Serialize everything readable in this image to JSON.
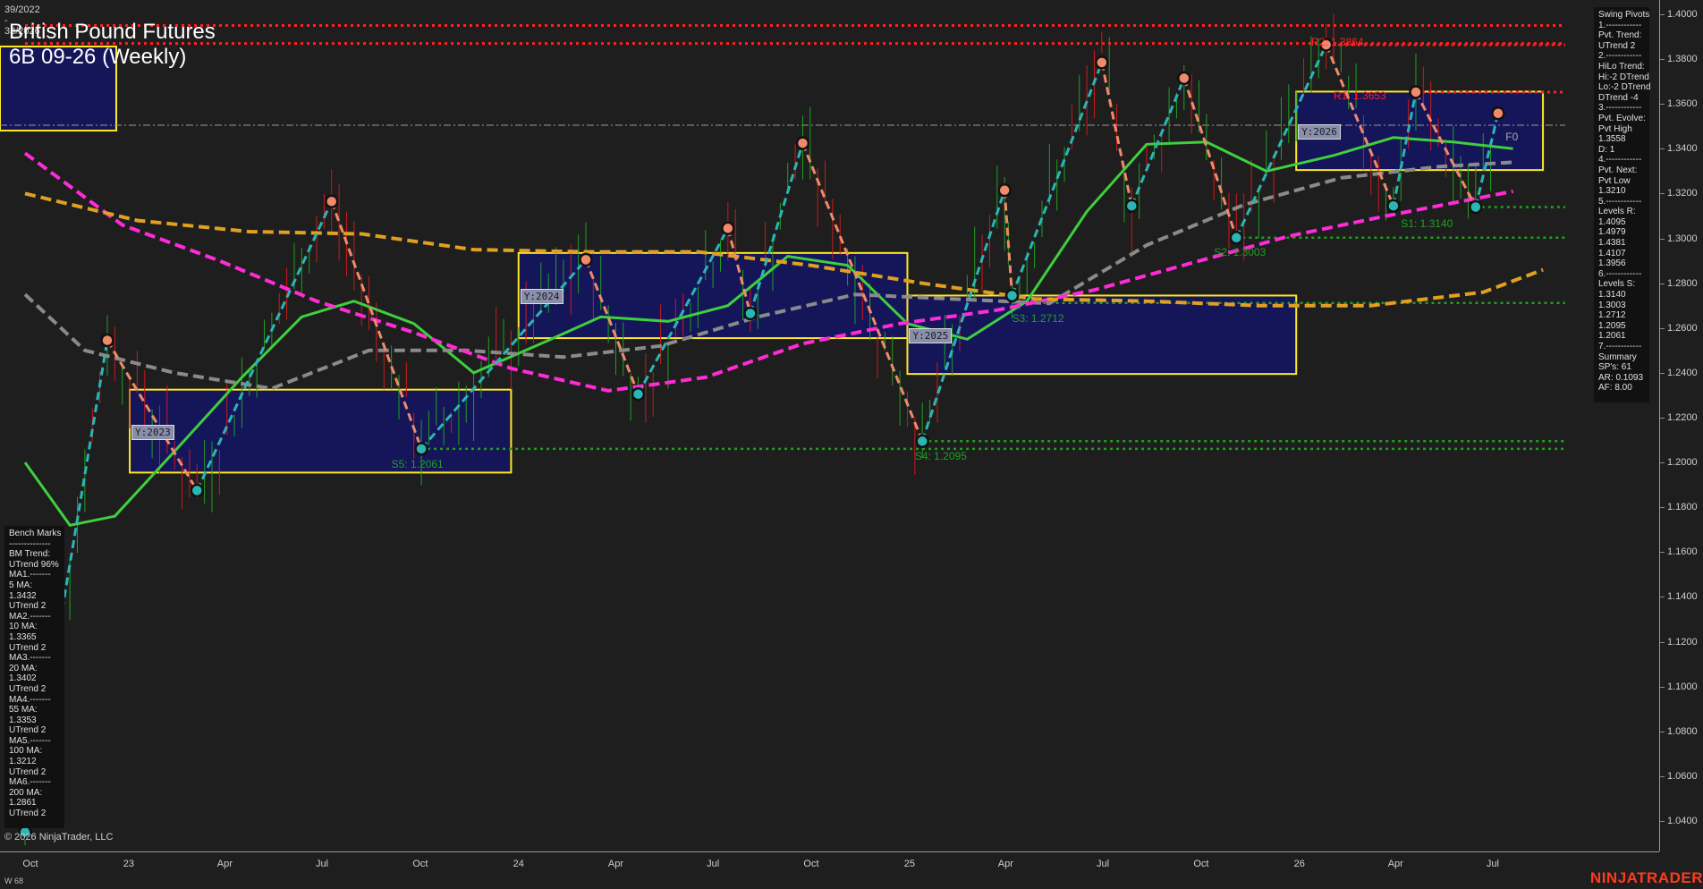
{
  "header": {
    "date_range": "39/2022 - 33/2026",
    "title": "British Pound Futures",
    "subtitle": "6B 09-26 (Weekly)"
  },
  "footer": {
    "copyright": "© 2026 NinjaTrader, LLC",
    "period": "W 68",
    "brand": "NINJATRADER"
  },
  "colors": {
    "background": "#1e1e1e",
    "bull_bar": "#1fa01f",
    "bear_bar": "#cc1a1a",
    "ma_green": "#3ecf3e",
    "ma_gray": "#8a8a8a",
    "ma_magenta": "#ff2bd6",
    "ma_orange": "#e0a020",
    "pivot_up": "#2bb5b5",
    "pivot_down": "#f08a6a",
    "box_fill": "#15155a",
    "box_border": "#ffe820",
    "resistance": "#ff2020",
    "support": "#1fa01f"
  },
  "swing_panel": {
    "lines": [
      "Swing Pivots",
      "1.------------",
      "Pvt. Trend:",
      "UTrend 2",
      "2.------------",
      "HiLo Trend:",
      "Hi:-2 DTrend",
      "Lo:-2 DTrend",
      "DTrend -4",
      "3.------------",
      "Pvt. Evolve:",
      "Pvt High",
      "1.3558",
      "D: 1",
      "4.------------",
      "Pvt. Next:",
      "Pvt Low",
      "1.3210",
      "5.------------",
      "Levels R:",
      "1.4095",
      "1.4979",
      "1.4381",
      "1.4107",
      "1.3956",
      "6.------------",
      "Levels S:",
      "1.3140",
      "1.3003",
      "1.2712",
      "1.2095",
      "1.2061",
      "7.------------",
      "Summary",
      "SP's: 61",
      "AR: 0.1093",
      "AF: 8.00"
    ]
  },
  "bench_panel": {
    "lines": [
      "Bench Marks",
      "--------------",
      "BM Trend:",
      "UTrend 96%",
      "MA1.-------",
      "5 MA:",
      "1.3432",
      "UTrend 2",
      "MA2.-------",
      "10 MA:",
      "1.3365",
      "UTrend 2",
      "MA3.-------",
      "20 MA:",
      "1.3402",
      "UTrend 2",
      "MA4.-------",
      "55 MA:",
      "1.3353",
      "UTrend 2",
      "MA5.-------",
      "100 MA:",
      "1.3212",
      "UTrend 2",
      "MA6.-------",
      "200 MA:",
      "1.2861",
      "UTrend 2"
    ]
  },
  "level_labels": {
    "r2": "R2: 1.3864",
    "r1": "R1: 1.3653",
    "s1": "S1: 1.3140",
    "s2": "S2: 1.3003",
    "s3": "S3: 1.2712",
    "s4": "S4: 1.2095",
    "s5": "S5: 1.2061",
    "f0": "F0"
  },
  "year_labels": [
    "Y:2023",
    "Y:2024",
    "Y:2025",
    "Y:2026"
  ],
  "chart_data": {
    "type": "line",
    "title": "British Pound Futures",
    "subtitle": "6B 09-26 (Weekly)",
    "y_axis": {
      "range": [
        1.03,
        1.405
      ],
      "ticks": [
        "1.4000",
        "1.3800",
        "1.3600",
        "1.3400",
        "1.3200",
        "1.3000",
        "1.2800",
        "1.2600",
        "1.2400",
        "1.2200",
        "1.2000",
        "1.1800",
        "1.1600",
        "1.1400",
        "1.1200",
        "1.1000",
        "1.0800",
        "1.0600",
        "1.0400"
      ]
    },
    "x_axis": {
      "ticks": [
        "Oct",
        "23",
        "Apr",
        "Jul",
        "Oct",
        "24",
        "Apr",
        "Jul",
        "Oct",
        "25",
        "Apr",
        "Jul",
        "Oct",
        "26",
        "Apr",
        "Jul"
      ]
    },
    "swing_pivots": [
      {
        "date": "2022-09-26",
        "price": 1.035,
        "kind": "low"
      },
      {
        "date": "2022-12-12",
        "price": 1.2545,
        "kind": "high"
      },
      {
        "date": "2023-03-06",
        "price": 1.1875,
        "kind": "low"
      },
      {
        "date": "2023-07-10",
        "price": 1.3165,
        "kind": "high"
      },
      {
        "date": "2023-10-02",
        "price": 1.2061,
        "kind": "low"
      },
      {
        "date": "2024-03-04",
        "price": 1.2905,
        "kind": "high"
      },
      {
        "date": "2024-04-22",
        "price": 1.2305,
        "kind": "low"
      },
      {
        "date": "2024-07-15",
        "price": 1.3045,
        "kind": "high"
      },
      {
        "date": "2024-08-05",
        "price": 1.2665,
        "kind": "low"
      },
      {
        "date": "2024-09-23",
        "price": 1.3425,
        "kind": "high"
      },
      {
        "date": "2025-01-13",
        "price": 1.2095,
        "kind": "low"
      },
      {
        "date": "2025-03-31",
        "price": 1.3215,
        "kind": "high"
      },
      {
        "date": "2025-04-07",
        "price": 1.2745,
        "kind": "low"
      },
      {
        "date": "2025-06-30",
        "price": 1.3785,
        "kind": "high"
      },
      {
        "date": "2025-07-28",
        "price": 1.3145,
        "kind": "low"
      },
      {
        "date": "2025-09-15",
        "price": 1.3715,
        "kind": "high"
      },
      {
        "date": "2025-11-03",
        "price": 1.3003,
        "kind": "low"
      },
      {
        "date": "2026-01-26",
        "price": 1.3864,
        "kind": "high"
      },
      {
        "date": "2026-03-30",
        "price": 1.3145,
        "kind": "low"
      },
      {
        "date": "2026-04-20",
        "price": 1.3653,
        "kind": "high"
      },
      {
        "date": "2026-06-15",
        "price": 1.314,
        "kind": "low"
      },
      {
        "date": "2026-07-06",
        "price": 1.3558,
        "kind": "high"
      }
    ],
    "moving_averages": [
      {
        "name": "20 MA",
        "color": "#3ecf3e",
        "points": [
          [
            "2022-09-26",
            1.2
          ],
          [
            "2022-11-07",
            1.172
          ],
          [
            "2022-12-19",
            1.176
          ],
          [
            "2023-02-13",
            1.205
          ],
          [
            "2023-04-17",
            1.238
          ],
          [
            "2023-06-12",
            1.265
          ],
          [
            "2023-07-31",
            1.272
          ],
          [
            "2023-09-25",
            1.262
          ],
          [
            "2023-11-20",
            1.24
          ],
          [
            "2024-01-22",
            1.253
          ],
          [
            "2024-03-18",
            1.265
          ],
          [
            "2024-05-20",
            1.263
          ],
          [
            "2024-07-15",
            1.27
          ],
          [
            "2024-09-09",
            1.292
          ],
          [
            "2024-11-04",
            1.288
          ],
          [
            "2024-12-30",
            1.262
          ],
          [
            "2025-02-24",
            1.255
          ],
          [
            "2025-04-21",
            1.272
          ],
          [
            "2025-06-16",
            1.312
          ],
          [
            "2025-08-11",
            1.342
          ],
          [
            "2025-10-06",
            1.343
          ],
          [
            "2025-12-01",
            1.33
          ],
          [
            "2026-02-02",
            1.337
          ],
          [
            "2026-03-30",
            1.345
          ],
          [
            "2026-05-25",
            1.343
          ],
          [
            "2026-07-20",
            1.34
          ]
        ]
      },
      {
        "name": "55 MA",
        "color": "#8a8a8a",
        "points": [
          [
            "2022-09-26",
            1.275
          ],
          [
            "2022-11-21",
            1.25
          ],
          [
            "2023-02-13",
            1.24
          ],
          [
            "2023-05-15",
            1.233
          ],
          [
            "2023-08-14",
            1.25
          ],
          [
            "2023-11-13",
            1.25
          ],
          [
            "2024-02-12",
            1.247
          ],
          [
            "2024-05-13",
            1.252
          ],
          [
            "2024-08-12",
            1.265
          ],
          [
            "2024-11-11",
            1.275
          ],
          [
            "2025-02-10",
            1.273
          ],
          [
            "2025-05-12",
            1.271
          ],
          [
            "2025-08-11",
            1.297
          ],
          [
            "2025-11-10",
            1.315
          ],
          [
            "2026-02-09",
            1.327
          ],
          [
            "2026-05-11",
            1.332
          ],
          [
            "2026-07-20",
            1.334
          ]
        ]
      },
      {
        "name": "100 MA",
        "color": "#ff2bd6",
        "points": [
          [
            "2022-09-26",
            1.338
          ],
          [
            "2022-12-26",
            1.306
          ],
          [
            "2023-03-27",
            1.29
          ],
          [
            "2023-06-26",
            1.272
          ],
          [
            "2023-09-25",
            1.258
          ],
          [
            "2023-12-25",
            1.242
          ],
          [
            "2024-03-25",
            1.232
          ],
          [
            "2024-06-24",
            1.238
          ],
          [
            "2024-09-23",
            1.253
          ],
          [
            "2024-12-23",
            1.262
          ],
          [
            "2025-03-24",
            1.268
          ],
          [
            "2025-06-23",
            1.277
          ],
          [
            "2025-09-22",
            1.289
          ],
          [
            "2025-12-22",
            1.301
          ],
          [
            "2026-03-23",
            1.31
          ],
          [
            "2026-07-20",
            1.321
          ]
        ]
      },
      {
        "name": "200 MA",
        "color": "#e0a020",
        "points": [
          [
            "2022-09-26",
            1.32
          ],
          [
            "2023-01-09",
            1.308
          ],
          [
            "2023-04-24",
            1.303
          ],
          [
            "2023-08-07",
            1.302
          ],
          [
            "2023-11-20",
            1.295
          ],
          [
            "2024-03-04",
            1.294
          ],
          [
            "2024-06-17",
            1.294
          ],
          [
            "2024-09-30",
            1.288
          ],
          [
            "2025-01-13",
            1.28
          ],
          [
            "2025-04-28",
            1.273
          ],
          [
            "2025-08-11",
            1.272
          ],
          [
            "2025-11-24",
            1.27
          ],
          [
            "2026-03-09",
            1.27
          ],
          [
            "2026-06-22",
            1.276
          ],
          [
            "2026-08-17",
            1.286
          ]
        ]
      }
    ],
    "yearly_ranges": [
      {
        "label": "Y:2023",
        "start": "2023-01-02",
        "end": "2023-12-25",
        "low": 1.1955,
        "high": 1.2325
      },
      {
        "label": "Y:2024",
        "start": "2024-01-01",
        "end": "2024-12-30",
        "low": 1.2555,
        "high": 1.2935
      },
      {
        "label": "Y:2025",
        "start": "2024-12-30",
        "end": "2025-12-29",
        "low": 1.2395,
        "high": 1.2745
      },
      {
        "label": "Y:2026",
        "start": "2025-12-29",
        "end": "2026-08-17",
        "low": 1.3305,
        "high": 1.3655
      }
    ],
    "levels": {
      "resistance": [
        {
          "name": "R2",
          "value": 1.3864,
          "start": "2026-01-26"
        },
        {
          "name": "R1",
          "value": 1.3653,
          "start": "2026-04-20"
        },
        {
          "name": "",
          "value": 1.395,
          "start": "2022-09-26"
        },
        {
          "name": "",
          "value": 1.387,
          "start": "2022-09-26"
        }
      ],
      "support": [
        {
          "name": "S1",
          "value": 1.314,
          "start": "2026-06-15"
        },
        {
          "name": "S2",
          "value": 1.3003,
          "start": "2025-11-03"
        },
        {
          "name": "S3",
          "value": 1.2712,
          "start": "2025-04-07"
        },
        {
          "name": "S4",
          "value": 1.2095,
          "start": "2025-01-13"
        },
        {
          "name": "S5",
          "value": 1.2061,
          "start": "2023-10-02"
        }
      ]
    },
    "grid": false,
    "legend": "none"
  }
}
